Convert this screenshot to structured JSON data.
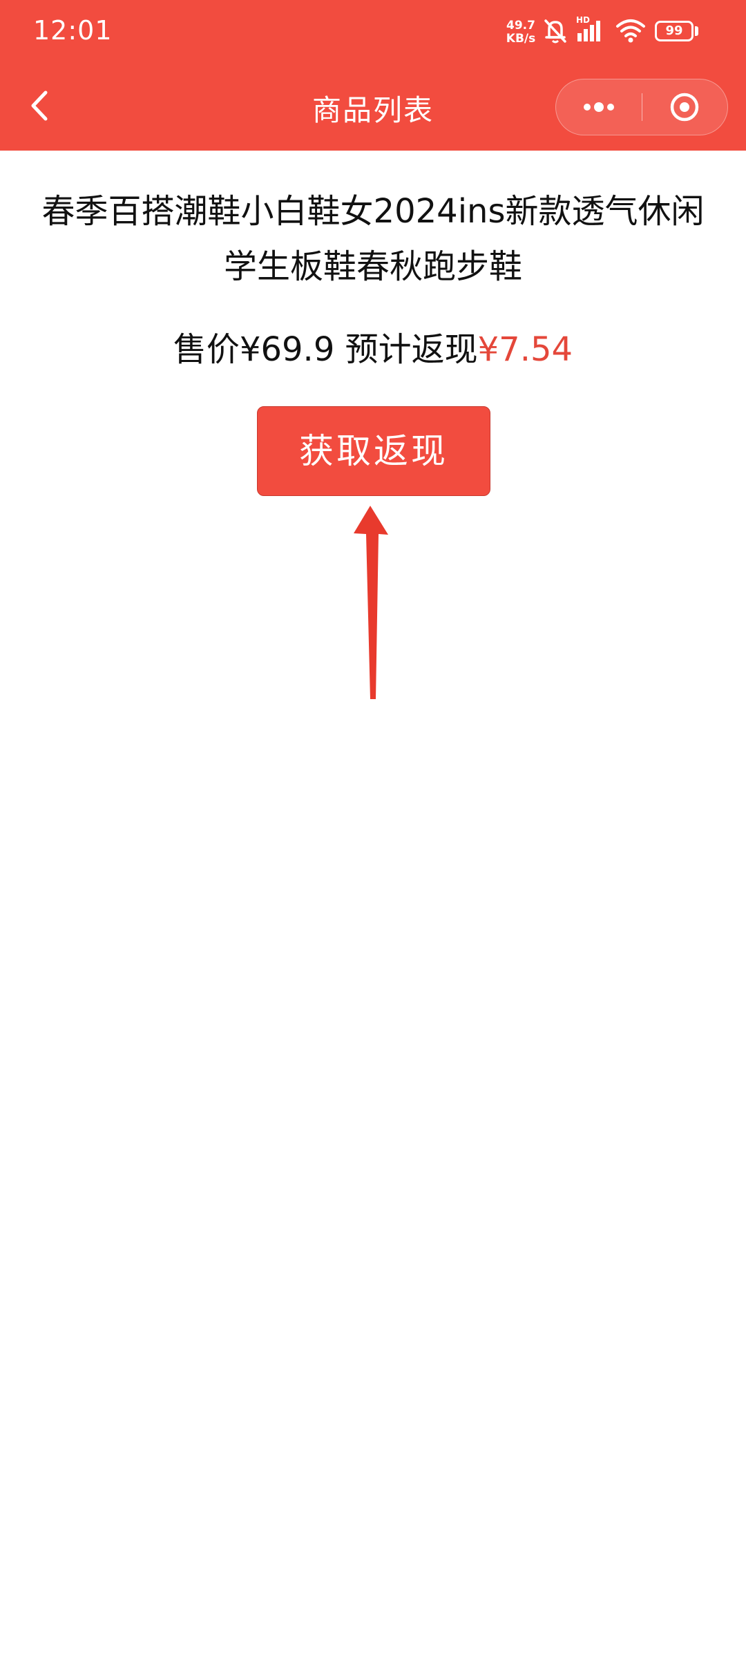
{
  "status_bar": {
    "time": "12:01",
    "network_speed_value": "49.7",
    "network_speed_unit": "KB/s",
    "signal_badge": "HD",
    "battery_level": "99",
    "icons": [
      "mute-bell-icon",
      "signal-icon",
      "wifi-icon",
      "battery-icon"
    ]
  },
  "nav": {
    "title": "商品列表",
    "back_icon": "chevron-left-icon",
    "capsule": {
      "more_icon": "more-dots-icon",
      "close_icon": "target-circle-icon"
    }
  },
  "product": {
    "title": "春季百搭潮鞋小白鞋女2024ins新款透气休闲学生板鞋春秋跑步鞋",
    "price_label": "售价",
    "price": "¥69.9",
    "cashback_label": "预计返现",
    "cashback": "¥7.54"
  },
  "cta": {
    "label": "获取返现"
  },
  "annotation": {
    "icon": "red-arrow-icon"
  },
  "colors": {
    "brand": "#f24c3f",
    "cashback": "#e4473a",
    "text": "#111111"
  }
}
